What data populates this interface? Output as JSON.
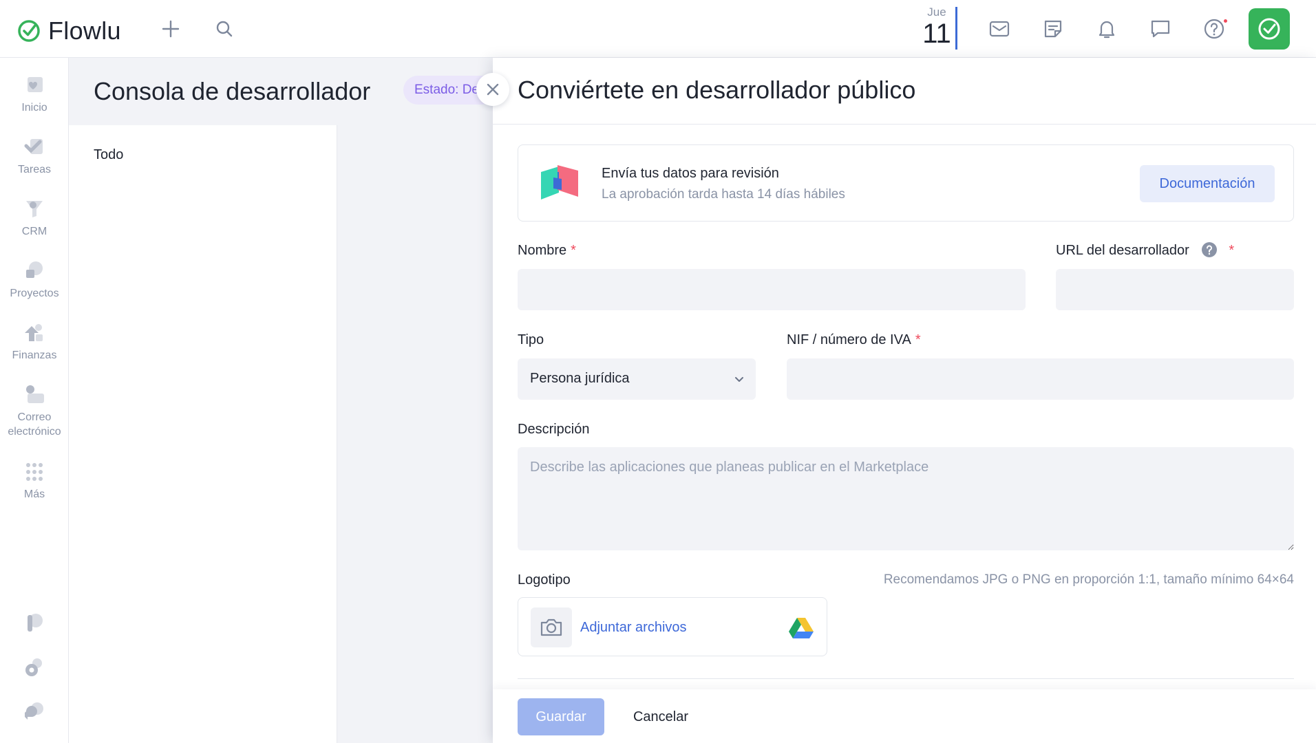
{
  "app": {
    "name": "Flowlu",
    "brand_color": "#36b35a",
    "accent_color": "#3d68d8"
  },
  "topbar": {
    "date_day": "Jue",
    "date_num": "11",
    "icons": [
      "add-icon",
      "search-icon",
      "mail-icon",
      "notes-icon",
      "bell-icon",
      "chat-icon",
      "help-icon",
      "check-icon"
    ]
  },
  "sidebar": {
    "items": [
      {
        "label": "Inicio",
        "icon": "home-icon"
      },
      {
        "label": "Tareas",
        "icon": "tasks-icon"
      },
      {
        "label": "CRM",
        "icon": "crm-funnel-icon"
      },
      {
        "label": "Proyectos",
        "icon": "projects-icon"
      },
      {
        "label": "Finanzas",
        "icon": "finance-icon"
      },
      {
        "label": "Correo electrónico",
        "icon": "email-icon"
      },
      {
        "label": "Más",
        "icon": "more-grid-icon"
      }
    ],
    "bottom_icons": [
      "pin-icon",
      "settings-icon",
      "support-chat-icon"
    ]
  },
  "page": {
    "title": "Consola de desarrollador",
    "status": "Estado: De",
    "list": [
      "Todo"
    ]
  },
  "panel": {
    "title": "Conviértete en desarrollador público",
    "info": {
      "title": "Envía tus datos para revisión",
      "subtitle": "La aprobación tarda hasta 14 días hábiles",
      "doc_button": "Documentación"
    },
    "fields": {
      "name_label": "Nombre",
      "name_value": "",
      "url_label": "URL del desarrollador",
      "url_value": "",
      "type_label": "Tipo",
      "type_value": "Persona jurídica",
      "vat_label": "NIF / número de IVA",
      "vat_value": "",
      "description_label": "Descripción",
      "description_placeholder": "Describe las aplicaciones que planeas publicar en el Marketplace",
      "logo_label": "Logotipo",
      "logo_hint": "Recomendamos JPG o PNG en proporción 1:1, tamaño mínimo 64×64",
      "attach_label": "Adjuntar archivos",
      "required_mark": "*"
    },
    "footer": {
      "save": "Guardar",
      "cancel": "Cancelar"
    }
  }
}
